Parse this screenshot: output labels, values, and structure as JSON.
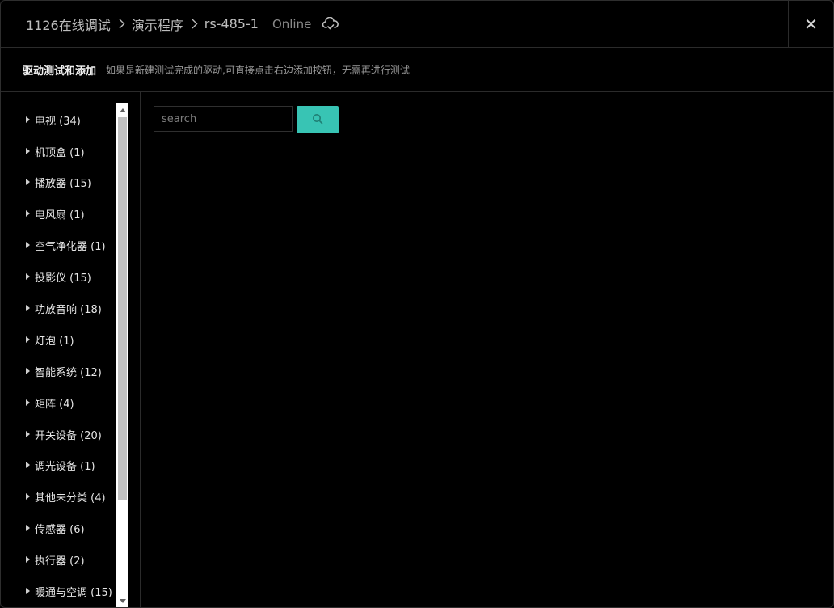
{
  "breadcrumb": {
    "items": [
      "1126在线调试",
      "演示程序",
      "rs-485-1"
    ],
    "status": "Online",
    "status_icon": "cloud-check-icon"
  },
  "close_icon": "close-icon",
  "subheader": {
    "title": "驱动测试和添加",
    "hint": "如果是新建测试完成的驱动,可直接点击右边添加按钮，无需再进行测试"
  },
  "categories": [
    {
      "label": "电视 (34)"
    },
    {
      "label": "机顶盒 (1)"
    },
    {
      "label": "播放器 (15)"
    },
    {
      "label": "电风扇 (1)"
    },
    {
      "label": "空气净化器 (1)"
    },
    {
      "label": "投影仪 (15)"
    },
    {
      "label": "功放音响 (18)"
    },
    {
      "label": "灯泡 (1)"
    },
    {
      "label": "智能系统 (12)"
    },
    {
      "label": "矩阵 (4)"
    },
    {
      "label": "开关设备 (20)"
    },
    {
      "label": "调光设备 (1)"
    },
    {
      "label": "其他未分类 (4)"
    },
    {
      "label": "传感器 (6)"
    },
    {
      "label": "执行器 (2)"
    },
    {
      "label": "暖通与空调 (15)"
    }
  ],
  "search": {
    "placeholder": "search",
    "value": "",
    "button_icon": "search-icon"
  },
  "colors": {
    "accent": "#38c4b4",
    "background": "#000000"
  }
}
